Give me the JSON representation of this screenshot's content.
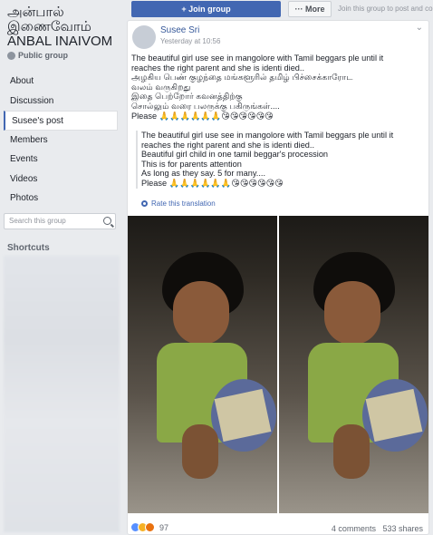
{
  "sidebar": {
    "group_title": "அன்பால் இணைவோம் ANBAL INAIVOM",
    "privacy": "Public group",
    "nav": [
      {
        "label": "About"
      },
      {
        "label": "Discussion"
      },
      {
        "label": "Susee's post"
      },
      {
        "label": "Members"
      },
      {
        "label": "Events"
      },
      {
        "label": "Videos"
      },
      {
        "label": "Photos"
      }
    ],
    "search_placeholder": "Search this group",
    "shortcuts_label": "Shortcuts"
  },
  "topbar": {
    "join_label": "+ Join group",
    "more_label": "··· More",
    "join_hint": "Join this group to post and co"
  },
  "post": {
    "author": "Susee Sri",
    "timestamp": "Yesterday at 10:56",
    "body_lines": [
      "The beautiful girl use see in mangolore with Tamil beggars ple until it",
      "reaches the right parent and she is identi died..",
      "அழகிய பெண் குழந்தை மங்களூரில் தமிழ் பிச்சைக்காரோட",
      "வலம் வருகிறது",
      "இதை பெற்றோர் கவனத்திற்கு",
      "சொல்லும் வரை பலருக்கு பகிருங்கள்....",
      "Please 🙏🙏🙏🙏🙏🙏😘😘😘😘😘😘"
    ],
    "quote_lines": [
      "The beautiful girl use see in mangolore with Tamil beggars ple until it",
      "reaches the right parent and she is identi died..",
      "Beautiful girl child in one tamil beggar's procession",
      "This is for parents attention",
      "As long as they say. 5 for many....",
      "Please 🙏🙏🙏🙏🙏🙏😘😘😘😘😘😘"
    ],
    "translate_label": "Rate this translation",
    "reaction_count": "97",
    "comments": "4 comments",
    "shares": "533 shares"
  },
  "colors": {
    "accent": "#4267b2",
    "link": "#365899",
    "background": "#e9ebee"
  }
}
